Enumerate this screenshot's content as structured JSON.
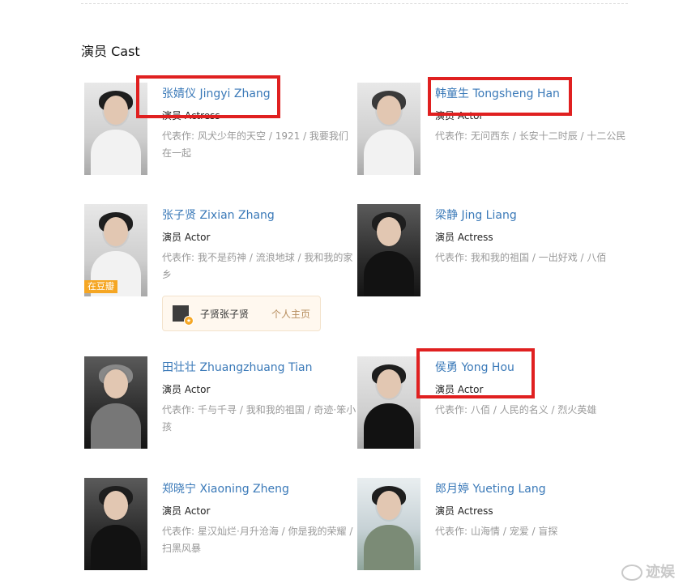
{
  "section": {
    "title": "演员 Cast"
  },
  "cast": [
    {
      "name": "张婧仪 Jingyi Zhang",
      "role": "演员 Actress",
      "works_label": "代表作:",
      "works": "风犬少年的天空 / 1921 / 我要我们在一起"
    },
    {
      "name": "韩童生 Tongsheng Han",
      "role": "演员 Actor",
      "works_label": "代表作:",
      "works": "无问西东 / 长安十二时辰 / 十二公民"
    },
    {
      "name": "张子贤 Zixian Zhang",
      "role": "演员 Actor",
      "works_label": "代表作:",
      "works": "我不是药神 / 流浪地球 / 我和我的家乡",
      "tag": "在豆瓣"
    },
    {
      "name": "梁静 Jing Liang",
      "role": "演员 Actress",
      "works_label": "代表作:",
      "works": "我和我的祖国 / 一出好戏 / 八佰"
    },
    {
      "name": "田壮壮 Zhuangzhuang Tian",
      "role": "演员 Actor",
      "works_label": "代表作:",
      "works": "千与千寻 / 我和我的祖国 / 奇迹·笨小孩"
    },
    {
      "name": "侯勇 Yong Hou",
      "role": "演员 Actor",
      "works_label": "代表作:",
      "works": "八佰 / 人民的名义 / 烈火英雄"
    },
    {
      "name": "郑晓宁 Xiaoning Zheng",
      "role": "演员 Actor",
      "works_label": "代表作:",
      "works": "星汉灿烂·月升沧海 / 你是我的荣耀 / 扫黑风暴"
    },
    {
      "name": "郎月婷 Yueting Lang",
      "role": "演员 Actress",
      "works_label": "代表作:",
      "works": "山海情 / 宠爱 / 盲探"
    }
  ],
  "homepage": {
    "name": "子贤张子贤",
    "link": "个人主页"
  },
  "watermark": {
    "text": "迹娱"
  },
  "colors": {
    "link": "#3a79b8",
    "highlight": "#e02020",
    "douban_tag": "#f5a623"
  }
}
